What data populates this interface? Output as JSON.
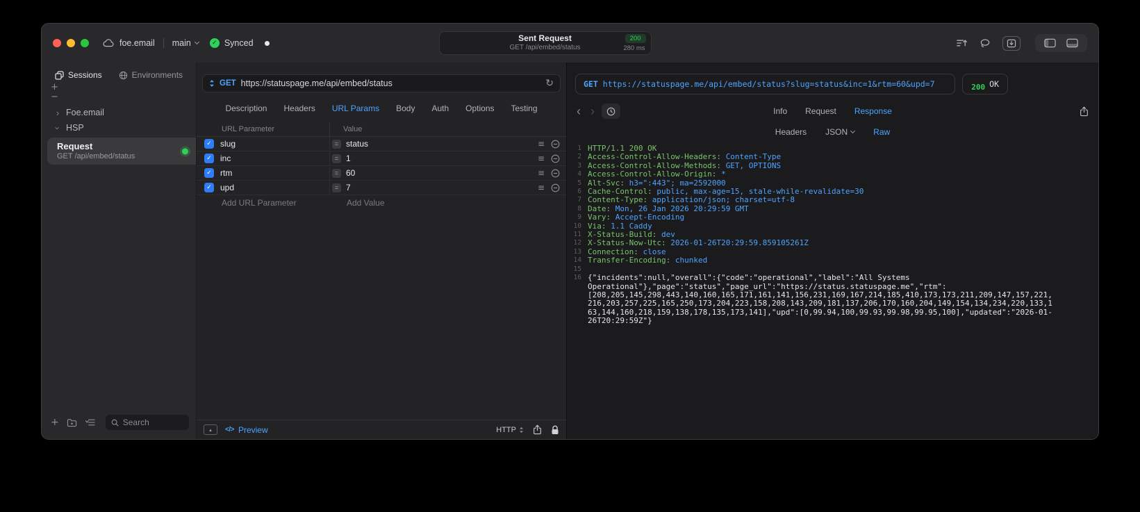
{
  "titlebar": {
    "project": "foe.email",
    "branch": "main",
    "sync_label": "Synced",
    "request_summary": {
      "title": "Sent Request",
      "subtitle": "GET /api/embed/status",
      "status_code": "200",
      "duration": "280 ms"
    }
  },
  "sidebar": {
    "tabs": [
      {
        "label": "Sessions"
      },
      {
        "label": "Environments"
      }
    ],
    "tree": [
      {
        "label": "Foe.email"
      },
      {
        "label": "HSP"
      }
    ],
    "request_item": {
      "title": "Request",
      "subtitle": "GET /api/embed/status"
    },
    "search_placeholder": "Search"
  },
  "request_panel": {
    "method": "GET",
    "url": "https://statuspage.me/api/embed/status",
    "tabs": [
      "Description",
      "Headers",
      "URL Params",
      "Body",
      "Auth",
      "Options",
      "Testing"
    ],
    "active_tab": "URL Params",
    "params_table": {
      "columns": [
        "URL Parameter",
        "Value"
      ],
      "rows": [
        {
          "enabled": true,
          "name": "slug",
          "value": "status"
        },
        {
          "enabled": true,
          "name": "inc",
          "value": "1"
        },
        {
          "enabled": true,
          "name": "rtm",
          "value": "60"
        },
        {
          "enabled": true,
          "name": "upd",
          "value": "7"
        }
      ],
      "add_name_placeholder": "Add URL Parameter",
      "add_value_placeholder": "Add Value"
    },
    "footer": {
      "preview_label": "Preview",
      "protocol_label": "HTTP"
    }
  },
  "response_panel": {
    "request_line": {
      "method": "GET",
      "url": "https://statuspage.me/api/embed/status?slug=status&inc=1&rtm=60&upd=7"
    },
    "status": {
      "code": "200",
      "text": "OK"
    },
    "tabs": [
      "Info",
      "Request",
      "Response"
    ],
    "active_tab": "Response",
    "subtabs": [
      "Headers",
      "JSON",
      "Raw"
    ],
    "active_subtab": "Raw",
    "body_lines": [
      {
        "n": 1,
        "kind": "status",
        "text": "HTTP/1.1 200 OK"
      },
      {
        "n": 2,
        "kind": "header",
        "key": "Access-Control-Allow-Headers",
        "value": "Content-Type"
      },
      {
        "n": 3,
        "kind": "header",
        "key": "Access-Control-Allow-Methods",
        "value": "GET, OPTIONS"
      },
      {
        "n": 4,
        "kind": "header",
        "key": "Access-Control-Allow-Origin",
        "value": "*"
      },
      {
        "n": 5,
        "kind": "header",
        "key": "Alt-Svc",
        "value": "h3=\":443\"; ma=2592000"
      },
      {
        "n": 6,
        "kind": "header",
        "key": "Cache-Control",
        "value": "public, max-age=15, stale-while-revalidate=30"
      },
      {
        "n": 7,
        "kind": "header",
        "key": "Content-Type",
        "value": "application/json; charset=utf-8"
      },
      {
        "n": 8,
        "kind": "header",
        "key": "Date",
        "value": "Mon, 26 Jan 2026 20:29:59 GMT"
      },
      {
        "n": 9,
        "kind": "header",
        "key": "Vary",
        "value": "Accept-Encoding"
      },
      {
        "n": 10,
        "kind": "header",
        "key": "Via",
        "value": "1.1 Caddy"
      },
      {
        "n": 11,
        "kind": "header",
        "key": "X-Status-Build",
        "value": "dev"
      },
      {
        "n": 12,
        "kind": "header",
        "key": "X-Status-Now-Utc",
        "value": "2026-01-26T20:29:59.859105261Z"
      },
      {
        "n": 13,
        "kind": "header",
        "key": "Connection",
        "value": "close"
      },
      {
        "n": 14,
        "kind": "header",
        "key": "Transfer-Encoding",
        "value": "chunked"
      },
      {
        "n": 15,
        "kind": "blank"
      },
      {
        "n": 16,
        "kind": "body",
        "text": "{\"incidents\":null,\"overall\":{\"code\":\"operational\",\"label\":\"All Systems Operational\"},\"page\":\"status\",\"page_url\":\"https://status.statuspage.me\",\"rtm\":[208,205,145,298,443,140,160,165,171,161,141,156,231,169,167,214,185,410,173,173,211,209,147,157,221,216,203,257,225,165,250,173,204,223,158,208,143,209,181,137,206,170,160,204,149,154,134,234,220,133,163,144,160,218,159,138,178,135,173,141],\"upd\":[0,99.94,100,99.93,99.98,99.95,100],\"updated\":\"2026-01-26T20:29:59Z\"}"
      }
    ]
  },
  "icons": {
    "check": "✓",
    "plus": "+",
    "minus": "−",
    "chevron_right": "›",
    "back_arrow": "‹",
    "forward_arrow": "›",
    "refresh": "↻",
    "drag_handle": "≡",
    "equals": "=",
    "code": "</>",
    "expand": "▴"
  },
  "colors": {
    "accent_blue": "#4da3ff",
    "status_green": "#30d158",
    "checkbox_blue": "#2f7df6",
    "code_key": "#79c46a",
    "code_value": "#4da3ff"
  }
}
